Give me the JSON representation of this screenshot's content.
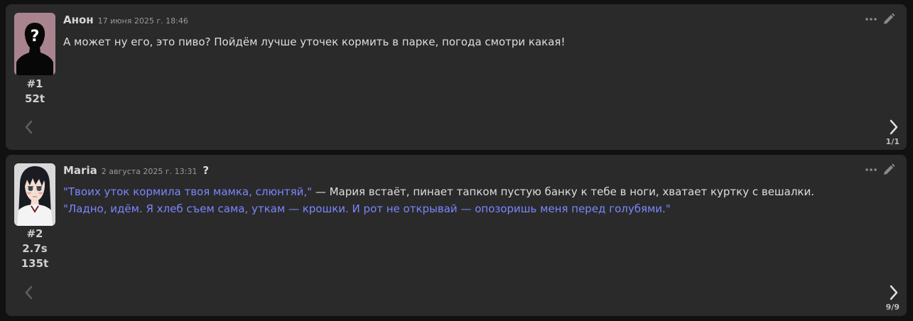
{
  "messages": [
    {
      "name": "Анон",
      "timestamp": "17 июня 2025 г. 18:46",
      "index": "#1",
      "tokens": "52t",
      "segments": [
        {
          "text": "А может ну его, это пиво? Пойдём лучше уточек кормить в парке, погода смотри какая!",
          "style": "plain"
        }
      ],
      "swipe_counter": "1/1",
      "avatar": "anonymous-silhouette"
    },
    {
      "name": "Maria",
      "timestamp": "2 августа 2025 г. 13:31",
      "question_mark": "?",
      "index": "#2",
      "gen_time": "2.7s",
      "tokens": "135t",
      "line1": [
        {
          "text": "\"Твоих уток кормила твоя мамка, слюнтяй,\"",
          "style": "quote"
        },
        {
          "text": " — Мария встаёт, пинает тапком пустую банку к тебе в ноги, хватает куртку с вешалки.",
          "style": "plain"
        }
      ],
      "line2": [
        {
          "text": "\"Ладно, идём. Я хлеб съем сама, уткам — крошки. И рот не открывай — опозоришь меня перед голубями.\"",
          "style": "quote"
        }
      ],
      "swipe_counter": "9/9",
      "avatar": "anime-girl-portrait"
    }
  ],
  "colors": {
    "background": "#111111",
    "message_bg": "#2a2a2a",
    "text": "#dedede",
    "quote": "#7a86ff",
    "muted": "#9a9a9a"
  },
  "icons": {
    "more": "ellipsis-icon",
    "edit": "pencil-icon",
    "swipe_left": "chevron-left-icon",
    "swipe_right": "chevron-right-icon"
  }
}
